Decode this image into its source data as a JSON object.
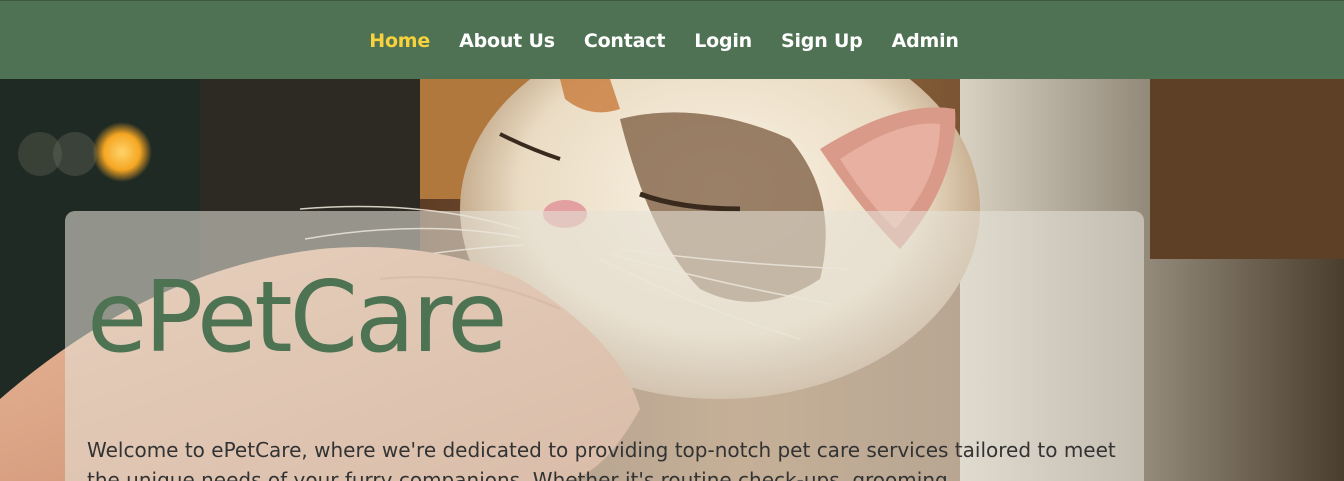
{
  "nav": {
    "items": [
      {
        "label": "Home",
        "active": true
      },
      {
        "label": "About Us",
        "active": false
      },
      {
        "label": "Contact",
        "active": false
      },
      {
        "label": "Login",
        "active": false
      },
      {
        "label": "Sign Up",
        "active": false
      },
      {
        "label": "Admin",
        "active": false
      }
    ]
  },
  "hero": {
    "title": "ePetCare",
    "intro": "Welcome to ePetCare, where we're dedicated to providing top-notch pet care services tailored to meet the unique needs of your furry companions. Whether it's routine check-ups, grooming"
  },
  "colors": {
    "navbar": "#4f7254",
    "nav_active": "#f7d23d",
    "brand_green": "#4d7353"
  }
}
